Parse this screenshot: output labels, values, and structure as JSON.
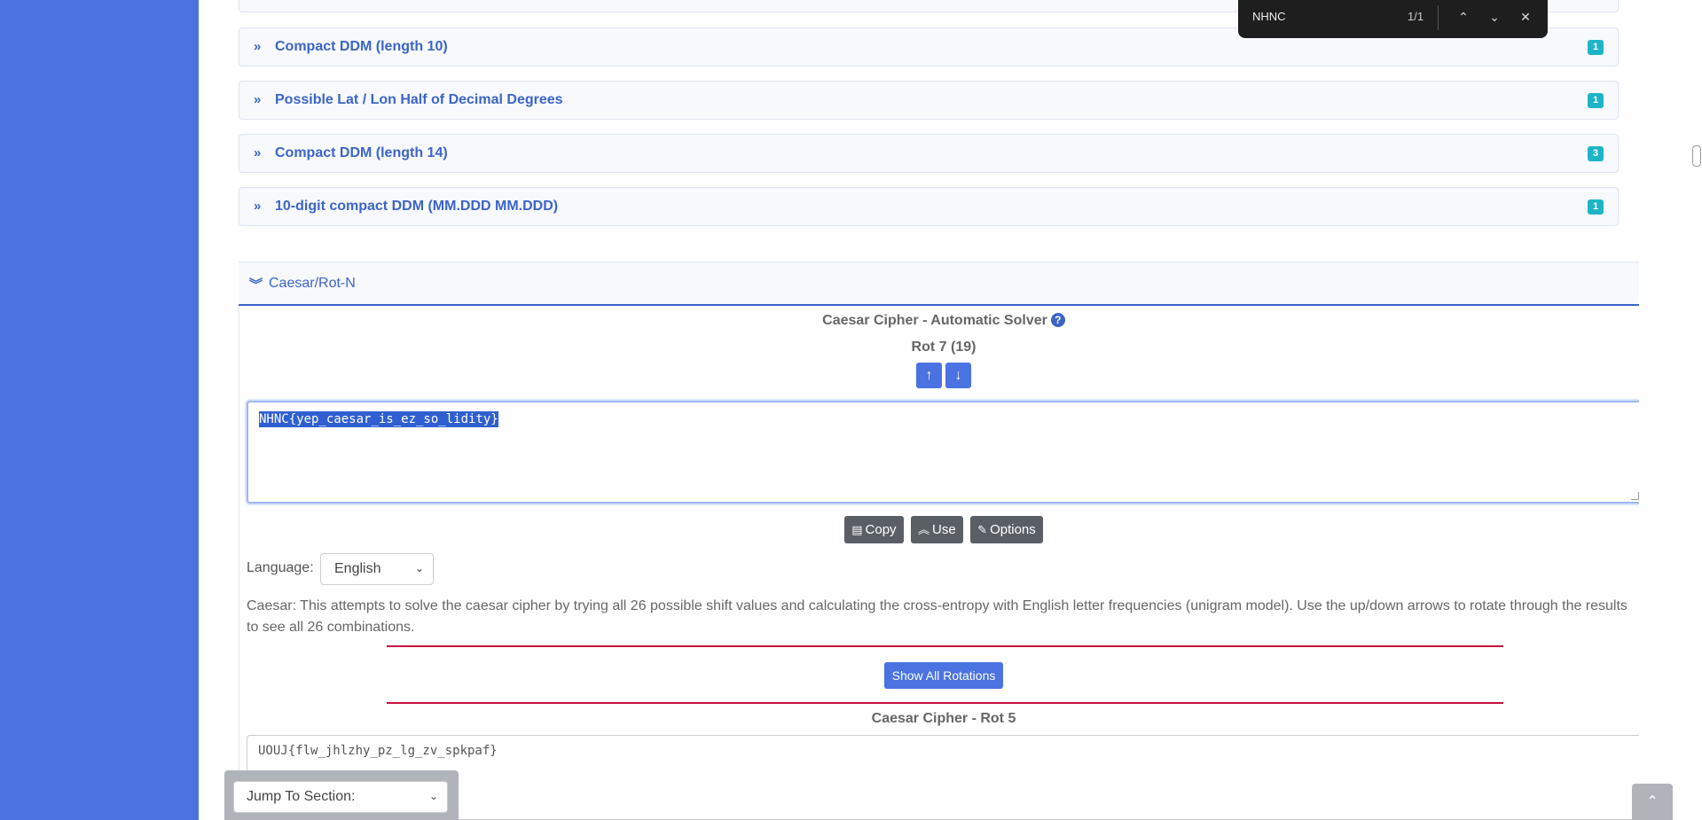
{
  "accordion": {
    "items": [
      {
        "label": "Compact DDM (length 10)",
        "count": "1"
      },
      {
        "label": "Possible Lat / Lon Half of Decimal Degrees",
        "count": "1"
      },
      {
        "label": "Compact DDM (length 14)",
        "count": "3"
      },
      {
        "label": "10-digit compact DDM (MM.DDD MM.DDD)",
        "count": "1"
      }
    ]
  },
  "section": {
    "title": "Caesar/Rot-N"
  },
  "solver": {
    "title": "Caesar Cipher - Automatic Solver",
    "help_glyph": "?",
    "rotation_label": "Rot 7 (19)",
    "result_text": "NHNC{yep_caesar_is_ez_so_lidity}",
    "buttons": {
      "copy": "Copy",
      "use": "Use",
      "options": "Options"
    },
    "language": {
      "label": "Language:",
      "selected": "English"
    },
    "description": "Caesar: This attempts to solve the caesar cipher by trying all 26 possible shift values and calculating the cross-entropy with English letter frequencies (unigram model). Use the up/down arrows to rotate through the results to see all 26 combinations.",
    "show_all_label": "Show All Rotations"
  },
  "rot5": {
    "title": "Caesar Cipher - Rot 5",
    "text": "UOUJ{flw_jhlzhy_pz_lg_zv_spkpaf}"
  },
  "jump": {
    "placeholder": "Jump To Section:"
  },
  "find_bar": {
    "query": "NHNC",
    "count": "1/1"
  },
  "colors": {
    "brand_blue": "#4a72e0",
    "link_blue": "#3c64c8",
    "badge_teal": "#1eb4c8",
    "divider_red": "#c8103e",
    "dark_button": "#5a5f66"
  }
}
